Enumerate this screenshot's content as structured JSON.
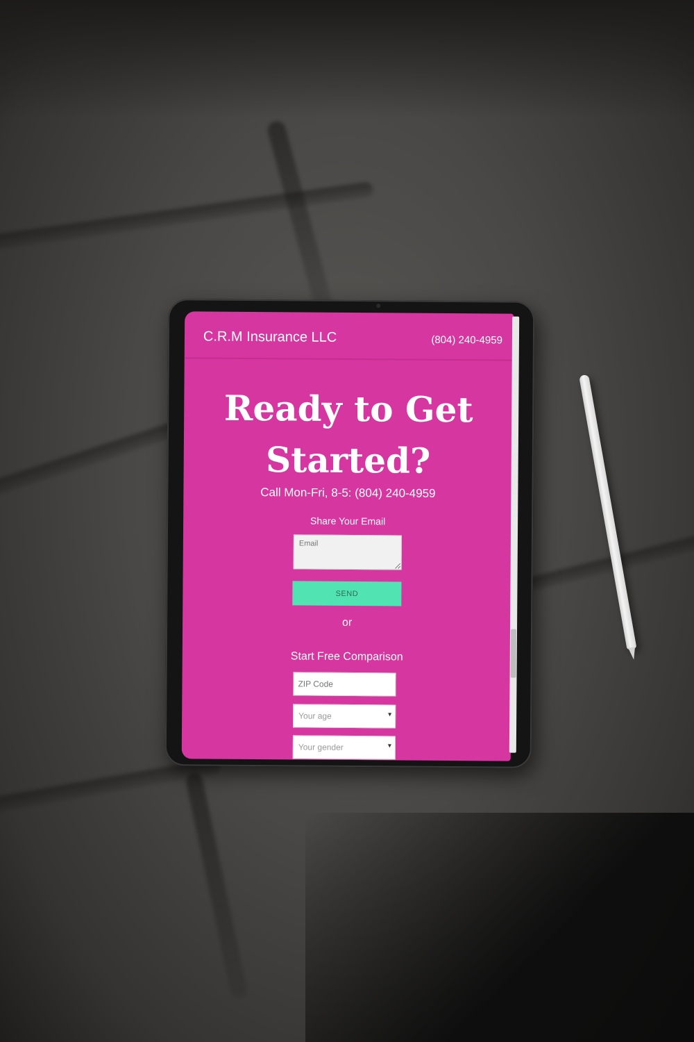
{
  "header": {
    "brand": "C.R.M Insurance LLC",
    "phone": "(804) 240-4959"
  },
  "hero": {
    "title_line1": "Ready to Get",
    "title_line2": "Started?"
  },
  "contact": {
    "call_text": "Call Mon-Fri, 8-5: (804) 240-4959"
  },
  "email_form": {
    "label": "Share Your Email",
    "email_placeholder": "Email",
    "send_label": "SEND"
  },
  "divider": {
    "or_label": "or"
  },
  "comparison_form": {
    "heading": "Start Free Comparison",
    "zip_placeholder": "ZIP Code",
    "age_selected": "Your age",
    "gender_selected": "Your gender"
  },
  "colors": {
    "screen_background": "#d6369f",
    "send_button": "#52e3b2",
    "text": "#ffffff"
  },
  "icons": {
    "select_arrow": "chevron-down-icon"
  }
}
